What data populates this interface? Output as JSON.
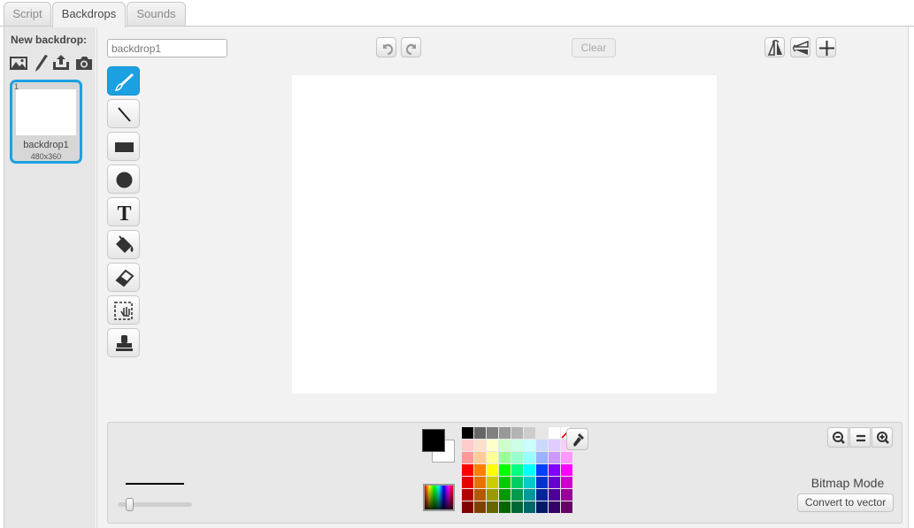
{
  "tabs": [
    {
      "label": "Script"
    },
    {
      "label": "Backdrops"
    },
    {
      "label": "Sounds"
    }
  ],
  "active_tab": "Backdrops",
  "left_pane": {
    "new_label": "New backdrop:",
    "new_icons": [
      "choose-from-library-icon",
      "paint-new-icon",
      "upload-file-icon",
      "camera-icon"
    ],
    "items": [
      {
        "number": "1",
        "name": "backdrop1",
        "size": "480x360",
        "selected": true
      }
    ]
  },
  "editor": {
    "name_value": "backdrop1",
    "undo_icon": "undo-icon",
    "redo_icon": "redo-icon",
    "clear_label": "Clear",
    "top_right_icons": [
      "flip-horizontal-icon",
      "flip-vertical-icon",
      "set-costume-center-icon"
    ],
    "tools": [
      {
        "name": "brush",
        "icon": "brush-icon",
        "active": true
      },
      {
        "name": "line",
        "icon": "line-icon"
      },
      {
        "name": "rectangle",
        "icon": "rectangle-icon"
      },
      {
        "name": "ellipse",
        "icon": "ellipse-icon"
      },
      {
        "name": "text",
        "icon": "text-icon",
        "glyph": "T"
      },
      {
        "name": "fill",
        "icon": "fill-bucket-icon"
      },
      {
        "name": "eraser",
        "icon": "eraser-icon"
      },
      {
        "name": "select",
        "icon": "select-icon"
      },
      {
        "name": "stamp",
        "icon": "stamp-icon"
      }
    ],
    "canvas_color": "#ffffff",
    "mode_label": "Bitmap Mode",
    "convert_label": "Convert to vector",
    "zoom_icons": [
      "zoom-out-icon",
      "zoom-reset-icon",
      "zoom-in-icon"
    ],
    "primary_color": "#000000",
    "secondary_color": "#ffffff",
    "brush_size_fraction": 0.15,
    "accent_color": "#1ba1e2",
    "palette": [
      [
        "#000000",
        "#666666",
        "#808080",
        "#999999",
        "#b3b3b3",
        "#cccccc",
        "#e6e6e6",
        "#ffffff",
        "none"
      ],
      [
        "#ffcccc",
        "#ffe0cc",
        "#ffffcc",
        "#ccffcc",
        "#ccffe5",
        "#ccffff",
        "#ccd9ff",
        "#e0ccff",
        "#ffccff"
      ],
      [
        "#ff9999",
        "#ffcc99",
        "#ffff99",
        "#99ff99",
        "#99ffcc",
        "#99ffff",
        "#99b3ff",
        "#cc99ff",
        "#ff99ff"
      ],
      [
        "#ff0000",
        "#ff8000",
        "#ffff00",
        "#00ff00",
        "#00ff80",
        "#00ffff",
        "#0040ff",
        "#8000ff",
        "#ff00ff"
      ],
      [
        "#e60000",
        "#e67300",
        "#cccc00",
        "#00cc00",
        "#00cc66",
        "#00cccc",
        "#0033cc",
        "#6600cc",
        "#cc00cc"
      ],
      [
        "#b30000",
        "#b35900",
        "#999900",
        "#009900",
        "#00994d",
        "#009999",
        "#002699",
        "#4d0099",
        "#990099"
      ],
      [
        "#800000",
        "#804000",
        "#666600",
        "#006600",
        "#006633",
        "#006666",
        "#001a66",
        "#330066",
        "#660066"
      ]
    ]
  }
}
